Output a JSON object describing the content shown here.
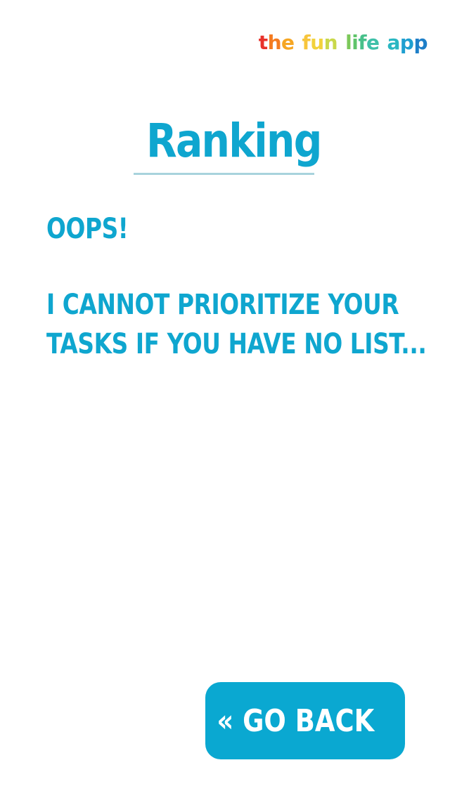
{
  "brand": {
    "words": [
      {
        "letters": [
          {
            "ch": "t",
            "color": "#e8322b"
          },
          {
            "ch": "h",
            "color": "#f47b20"
          },
          {
            "ch": "e",
            "color": "#f6a623"
          }
        ]
      },
      {
        "letters": [
          {
            "ch": "f",
            "color": "#f7c53c"
          },
          {
            "ch": "u",
            "color": "#f2d23b"
          },
          {
            "ch": "n",
            "color": "#c9d84a"
          }
        ]
      },
      {
        "letters": [
          {
            "ch": "l",
            "color": "#7cc85a"
          },
          {
            "ch": "i",
            "color": "#5fc46a"
          },
          {
            "ch": "f",
            "color": "#47c08a"
          },
          {
            "ch": "e",
            "color": "#3fc0a8"
          }
        ]
      },
      {
        "letters": [
          {
            "ch": "a",
            "color": "#2ab7c2"
          },
          {
            "ch": "p",
            "color": "#1e9fd0"
          },
          {
            "ch": "p",
            "color": "#1e7fc8"
          }
        ]
      }
    ]
  },
  "header": {
    "title": "Ranking"
  },
  "message": {
    "oops": "OOPS!",
    "line1": "I CANNOT PRIORITIZE YOUR",
    "line2": "TASKS IF YOU HAVE NO LIST..."
  },
  "actions": {
    "back_label": "« GO BACK"
  },
  "colors": {
    "accent": "#0fa6cf",
    "button": "#0aa8d1",
    "underline": "#a8d3dd"
  }
}
